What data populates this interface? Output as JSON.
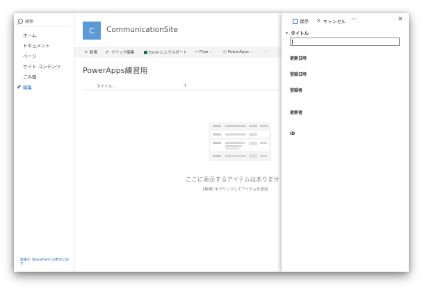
{
  "nav": {
    "search_label": "検索",
    "items": [
      "ホーム",
      "ドキュメント",
      "ページ",
      "サイト コンテンツ",
      "ごみ箱"
    ],
    "edit_label": "編集",
    "back_link": "従来の SharePoint の表示に戻す"
  },
  "site": {
    "logo_letter": "C",
    "logo_color": "#5b9bd5",
    "title": "CommunicationSite"
  },
  "commands": {
    "new": "新規",
    "quick_edit": "クイック編集",
    "export": "Excel にエクスポート",
    "flow": "Flow",
    "powerapps": "PowerApps",
    "more": "···"
  },
  "list": {
    "title": "PowerApps練習用",
    "column_header": "タイトル",
    "add_column": "+",
    "empty_title": "ここに表示するアイテムはありませ",
    "empty_sub": "[新規] をクリックしてアイテムを追加"
  },
  "panel": {
    "save": "保存",
    "cancel": "キャンセル",
    "more": "···",
    "close": "✕",
    "section": "タイトル",
    "title_value": "",
    "fields": [
      "更新日時",
      "登録日時",
      "登録者",
      "更新者",
      "ID"
    ]
  },
  "colors": {
    "accent": "#2b6cb0",
    "excel": "#217346",
    "powerapps": "#742774"
  }
}
